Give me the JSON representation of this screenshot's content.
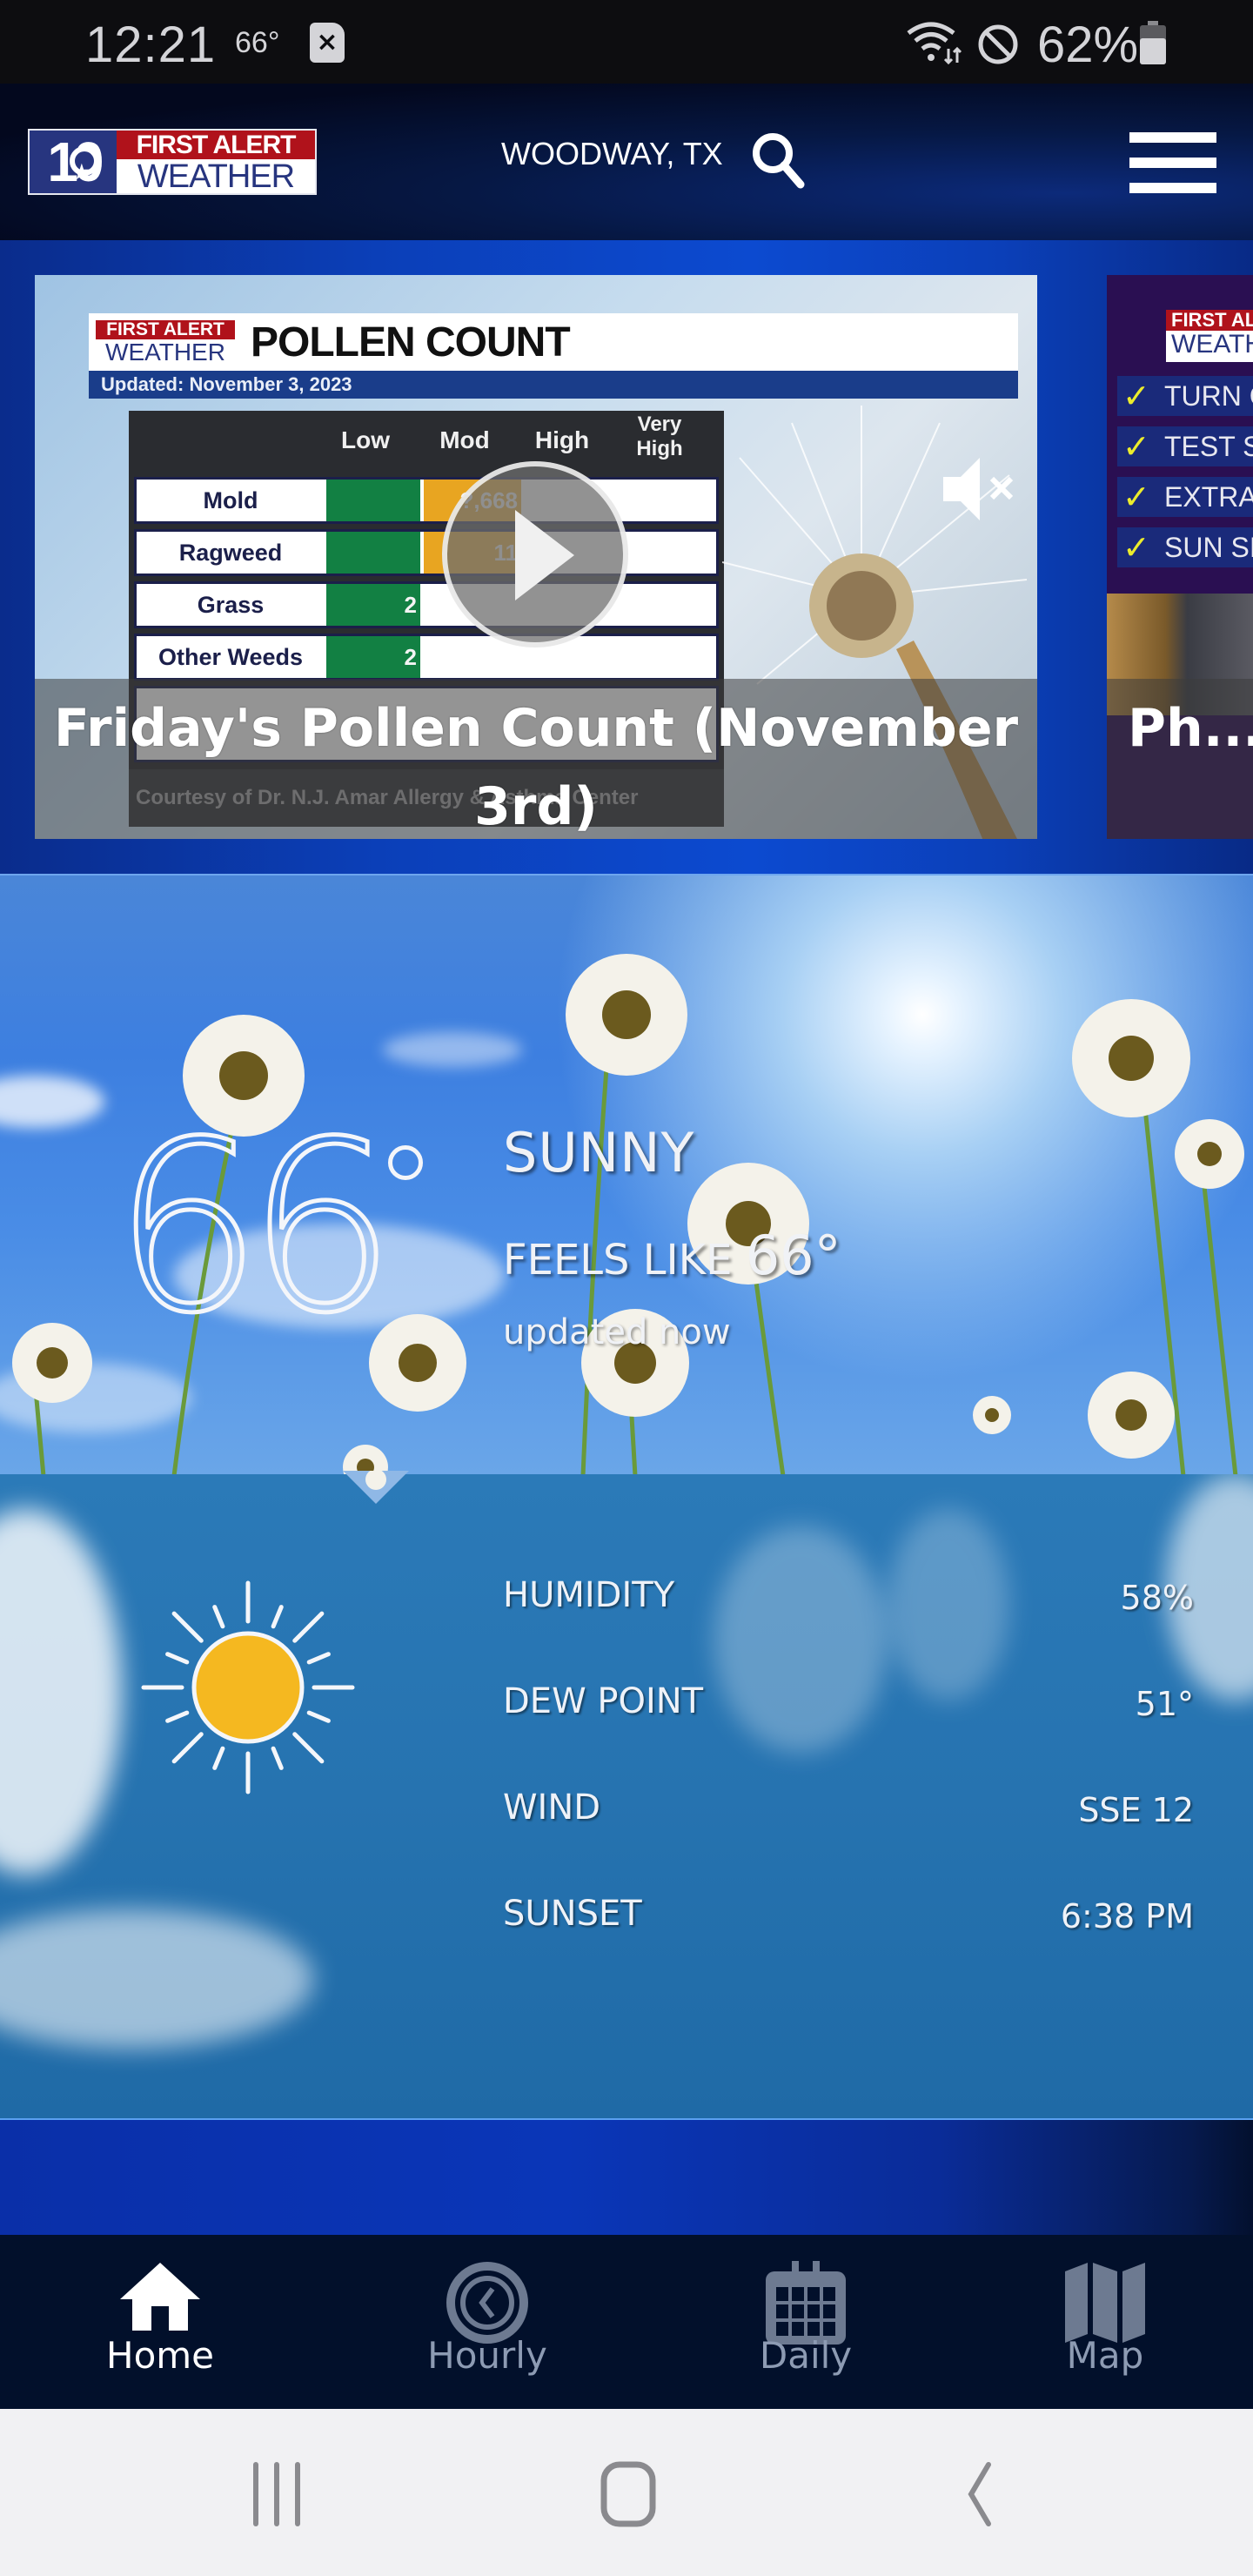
{
  "status_bar": {
    "time": "12:21",
    "temperature": "66°",
    "notification_icon": "app-notification-icon",
    "battery_percent": "62%",
    "icons": [
      "wifi-icon",
      "do-not-disturb-icon",
      "battery-icon"
    ]
  },
  "header": {
    "logo": {
      "number": "10",
      "line1": "FIRST ALERT",
      "line2": "WEATHER"
    },
    "location": "WOODWAY, TX",
    "search_icon": "search-icon",
    "menu_icon": "hamburger-menu-icon"
  },
  "carousel": {
    "cards": [
      {
        "caption": "Friday's Pollen Count (November 3rd)",
        "graphic": {
          "brand_line1": "FIRST ALERT",
          "brand_line2": "WEATHER",
          "title": "POLLEN COUNT",
          "updated": "Updated: November 3, 2023",
          "columns": [
            "Low",
            "Mod",
            "High",
            "Very High"
          ],
          "rows": [
            {
              "label": "Mold",
              "level": "Mod",
              "value": "?,668"
            },
            {
              "label": "Ragweed",
              "level": "Mod",
              "value": "11"
            },
            {
              "label": "Grass",
              "level": "Low",
              "value": "2"
            },
            {
              "label": "Other Weeds",
              "level": "Low",
              "value": "2"
            }
          ],
          "footer": "Courtesy of Dr. N.J. Amar Allergy & Asthma Center"
        },
        "play_icon": "play-icon",
        "mute_icon": "muted-speaker-icon"
      },
      {
        "caption": "Ph... With...",
        "graphic": {
          "brand_line1": "FIRST ALERT",
          "brand_line2": "WEATHER",
          "checklist": [
            "TURN C",
            "TEST S",
            "EXTRA",
            "SUN SI"
          ]
        }
      }
    ]
  },
  "current": {
    "temperature": "66",
    "condition": "SUNNY",
    "feels_like_label": "FEELS LIKE",
    "feels_like_value": "66°",
    "updated": "updated now",
    "icon": "sunny-icon"
  },
  "details": [
    {
      "label": "HUMIDITY",
      "value": "58%"
    },
    {
      "label": "DEW POINT",
      "value": "51°"
    },
    {
      "label": "WIND",
      "value": "SSE 12"
    },
    {
      "label": "SUNSET",
      "value": "6:38 PM"
    }
  ],
  "bottom_nav": {
    "items": [
      {
        "label": "Home",
        "icon": "home-icon",
        "active": true
      },
      {
        "label": "Hourly",
        "icon": "clock-icon",
        "active": false
      },
      {
        "label": "Daily",
        "icon": "calendar-icon",
        "active": false
      },
      {
        "label": "Map",
        "icon": "map-icon",
        "active": false
      }
    ]
  },
  "system_nav": {
    "recents": "recent-apps-icon",
    "home": "home-button-icon",
    "back": "back-icon"
  },
  "colors": {
    "header_bg": "#03081e",
    "accent_blue": "#0b3fb8",
    "nav_bg": "#02102b",
    "nav_active": "#ffffff",
    "nav_inactive": "#8d9bb3",
    "sun_yellow": "#f5b820",
    "details_bg": "#2673b0",
    "pollen_low": "#128043",
    "pollen_mod": "#e8a521",
    "brand_red": "#b0121b",
    "brand_navy": "#27357f"
  }
}
